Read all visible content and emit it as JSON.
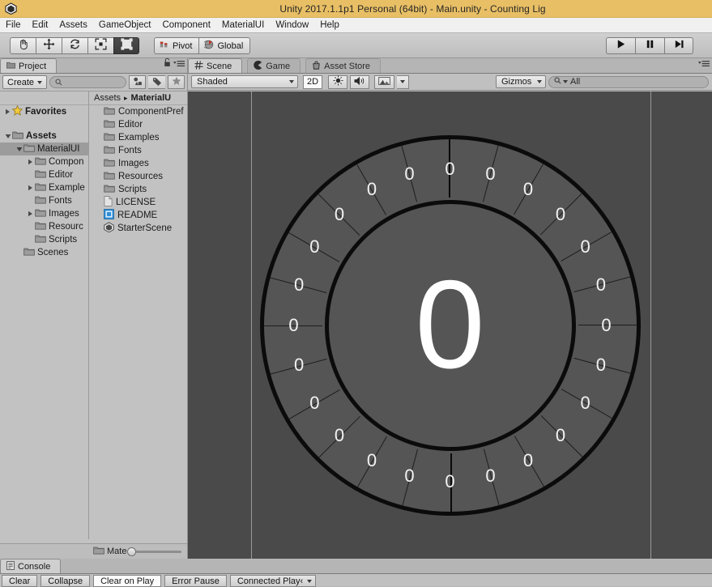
{
  "window": {
    "title": "Unity 2017.1.1p1 Personal (64bit) - Main.unity - Counting Lig",
    "logo_icon": "unity-logo-icon"
  },
  "menubar": {
    "items": [
      "File",
      "Edit",
      "Assets",
      "GameObject",
      "Component",
      "MaterialUI",
      "Window",
      "Help"
    ]
  },
  "toolbar": {
    "transform_tools": [
      {
        "name": "hand-tool",
        "icon": "hand-icon",
        "active": false
      },
      {
        "name": "move-tool",
        "icon": "move-arrows-icon",
        "active": false
      },
      {
        "name": "rotate-tool",
        "icon": "rotate-icon",
        "active": false
      },
      {
        "name": "scale-tool",
        "icon": "scale-icon",
        "active": false
      },
      {
        "name": "rect-tool",
        "icon": "rect-transform-icon",
        "active": true
      }
    ],
    "pivot_label": "Pivot",
    "pivot_icon": "pivot-icon",
    "handle_label": "Global",
    "handle_icon": "globe-icon",
    "play_label": "Play",
    "pause_label": "Pause",
    "step_label": "Step"
  },
  "project": {
    "tab_label": "Project",
    "tab_icon": "project-folder-icon",
    "lock_icon": "lock-icon",
    "menu_icon": "panel-menu-icon",
    "create_label": "Create",
    "search_placeholder": "",
    "search_value": "",
    "search_icon": "search-icon",
    "filter_buttons": [
      {
        "name": "type-filter-button",
        "icon": "type-filter-icon"
      },
      {
        "name": "label-filter-button",
        "icon": "label-tag-icon"
      },
      {
        "name": "favorites-filter-button",
        "icon": "star-icon"
      }
    ],
    "tree": [
      {
        "label": "Favorites",
        "icon": "star-icon",
        "indent": 0,
        "arrow": "collapsed",
        "bold": true,
        "selected": false
      },
      {
        "label": "",
        "icon": "none",
        "indent": 0,
        "arrow": "none",
        "bold": false,
        "selected": false
      },
      {
        "label": "Assets",
        "icon": "folder-icon",
        "indent": 0,
        "arrow": "expanded",
        "bold": true,
        "selected": false
      },
      {
        "label": "MaterialUI",
        "icon": "folder-icon",
        "indent": 1,
        "arrow": "expanded",
        "bold": false,
        "selected": true
      },
      {
        "label": "Compon",
        "icon": "folder-icon",
        "indent": 2,
        "arrow": "collapsed",
        "bold": false,
        "selected": false
      },
      {
        "label": "Editor",
        "icon": "folder-icon",
        "indent": 2,
        "arrow": "none",
        "bold": false,
        "selected": false
      },
      {
        "label": "Example",
        "icon": "folder-icon",
        "indent": 2,
        "arrow": "collapsed",
        "bold": false,
        "selected": false
      },
      {
        "label": "Fonts",
        "icon": "folder-icon",
        "indent": 2,
        "arrow": "none",
        "bold": false,
        "selected": false
      },
      {
        "label": "Images",
        "icon": "folder-icon",
        "indent": 2,
        "arrow": "collapsed",
        "bold": false,
        "selected": false
      },
      {
        "label": "Resourc",
        "icon": "folder-icon",
        "indent": 2,
        "arrow": "none",
        "bold": false,
        "selected": false
      },
      {
        "label": "Scripts",
        "icon": "folder-icon",
        "indent": 2,
        "arrow": "none",
        "bold": false,
        "selected": false
      },
      {
        "label": "Scenes",
        "icon": "folder-icon",
        "indent": 1,
        "arrow": "none",
        "bold": false,
        "selected": false
      }
    ],
    "breadcrumb": {
      "root": "Assets",
      "separator": "▸",
      "current": "MaterialU"
    },
    "items": [
      {
        "label": "ComponentPref",
        "icon": "folder-icon"
      },
      {
        "label": "Editor",
        "icon": "folder-icon"
      },
      {
        "label": "Examples",
        "icon": "folder-icon"
      },
      {
        "label": "Fonts",
        "icon": "folder-icon"
      },
      {
        "label": "Images",
        "icon": "folder-icon"
      },
      {
        "label": "Resources",
        "icon": "folder-icon"
      },
      {
        "label": "Scripts",
        "icon": "folder-icon"
      },
      {
        "label": "LICENSE",
        "icon": "text-file-icon"
      },
      {
        "label": "README",
        "icon": "readme-file-icon"
      },
      {
        "label": "StarterScene",
        "icon": "unity-scene-icon"
      }
    ],
    "footer": {
      "label": "Mate",
      "folder_icon": "folder-icon",
      "zoom_slider": "zoom-slider"
    }
  },
  "scene": {
    "tabs": [
      {
        "label": "Scene",
        "icon": "scene-grid-icon",
        "active": true
      },
      {
        "label": "Game",
        "icon": "game-pacman-icon",
        "active": false
      },
      {
        "label": "Asset Store",
        "icon": "asset-store-icon",
        "active": false
      }
    ],
    "draw_mode": "Shaded",
    "two_d_label": "2D",
    "two_d_on": true,
    "lighting_icon": "sun-icon",
    "audio_icon": "speaker-icon",
    "effects_icon": "image-effects-icon",
    "gizmos_label": "Gizmos",
    "search_value": "All",
    "search_icon": "search-icon",
    "menu_icon": "panel-menu-icon"
  },
  "counting_wheel": {
    "center_value": "0",
    "segment_count": 24,
    "segment_values": [
      "0",
      "0",
      "0",
      "0",
      "0",
      "0",
      "0",
      "0",
      "0",
      "0",
      "0",
      "0",
      "0",
      "0",
      "0",
      "0",
      "0",
      "0",
      "0",
      "0",
      "0",
      "0",
      "0",
      "0"
    ],
    "ring_fill": "#555555",
    "outline_color": "#0b0b0b",
    "text_color": "#ffffff",
    "background": "#4a4a4a"
  },
  "console": {
    "tab_label": "Console",
    "tab_icon": "console-icon",
    "buttons": [
      {
        "label": "Clear",
        "name": "clear-button",
        "on": false,
        "dropdown": false
      },
      {
        "label": "Collapse",
        "name": "collapse-button",
        "on": false,
        "dropdown": false
      },
      {
        "label": "Clear on Play",
        "name": "clear-on-play-button",
        "on": true,
        "dropdown": false
      },
      {
        "label": "Error Pause",
        "name": "error-pause-button",
        "on": false,
        "dropdown": false
      },
      {
        "label": "Connected Play‹",
        "name": "connected-player-dropdown",
        "on": false,
        "dropdown": true
      }
    ]
  },
  "colors": {
    "titlebar": "#e8bf65",
    "chrome": "#c2c2c2",
    "scene_bg": "#4a4a4a"
  }
}
